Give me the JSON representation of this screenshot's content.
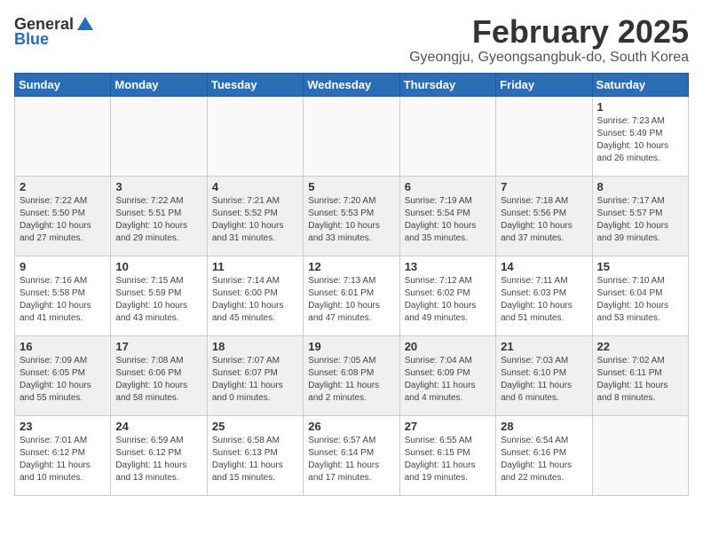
{
  "header": {
    "logo_general": "General",
    "logo_blue": "Blue",
    "month_title": "February 2025",
    "subtitle": "Gyeongju, Gyeongsangbuk-do, South Korea"
  },
  "weekdays": [
    "Sunday",
    "Monday",
    "Tuesday",
    "Wednesday",
    "Thursday",
    "Friday",
    "Saturday"
  ],
  "weeks": [
    [
      {
        "day": "",
        "info": ""
      },
      {
        "day": "",
        "info": ""
      },
      {
        "day": "",
        "info": ""
      },
      {
        "day": "",
        "info": ""
      },
      {
        "day": "",
        "info": ""
      },
      {
        "day": "",
        "info": ""
      },
      {
        "day": "1",
        "info": "Sunrise: 7:23 AM\nSunset: 5:49 PM\nDaylight: 10 hours\nand 26 minutes."
      }
    ],
    [
      {
        "day": "2",
        "info": "Sunrise: 7:22 AM\nSunset: 5:50 PM\nDaylight: 10 hours\nand 27 minutes."
      },
      {
        "day": "3",
        "info": "Sunrise: 7:22 AM\nSunset: 5:51 PM\nDaylight: 10 hours\nand 29 minutes."
      },
      {
        "day": "4",
        "info": "Sunrise: 7:21 AM\nSunset: 5:52 PM\nDaylight: 10 hours\nand 31 minutes."
      },
      {
        "day": "5",
        "info": "Sunrise: 7:20 AM\nSunset: 5:53 PM\nDaylight: 10 hours\nand 33 minutes."
      },
      {
        "day": "6",
        "info": "Sunrise: 7:19 AM\nSunset: 5:54 PM\nDaylight: 10 hours\nand 35 minutes."
      },
      {
        "day": "7",
        "info": "Sunrise: 7:18 AM\nSunset: 5:56 PM\nDaylight: 10 hours\nand 37 minutes."
      },
      {
        "day": "8",
        "info": "Sunrise: 7:17 AM\nSunset: 5:57 PM\nDaylight: 10 hours\nand 39 minutes."
      }
    ],
    [
      {
        "day": "9",
        "info": "Sunrise: 7:16 AM\nSunset: 5:58 PM\nDaylight: 10 hours\nand 41 minutes."
      },
      {
        "day": "10",
        "info": "Sunrise: 7:15 AM\nSunset: 5:59 PM\nDaylight: 10 hours\nand 43 minutes."
      },
      {
        "day": "11",
        "info": "Sunrise: 7:14 AM\nSunset: 6:00 PM\nDaylight: 10 hours\nand 45 minutes."
      },
      {
        "day": "12",
        "info": "Sunrise: 7:13 AM\nSunset: 6:01 PM\nDaylight: 10 hours\nand 47 minutes."
      },
      {
        "day": "13",
        "info": "Sunrise: 7:12 AM\nSunset: 6:02 PM\nDaylight: 10 hours\nand 49 minutes."
      },
      {
        "day": "14",
        "info": "Sunrise: 7:11 AM\nSunset: 6:03 PM\nDaylight: 10 hours\nand 51 minutes."
      },
      {
        "day": "15",
        "info": "Sunrise: 7:10 AM\nSunset: 6:04 PM\nDaylight: 10 hours\nand 53 minutes."
      }
    ],
    [
      {
        "day": "16",
        "info": "Sunrise: 7:09 AM\nSunset: 6:05 PM\nDaylight: 10 hours\nand 55 minutes."
      },
      {
        "day": "17",
        "info": "Sunrise: 7:08 AM\nSunset: 6:06 PM\nDaylight: 10 hours\nand 58 minutes."
      },
      {
        "day": "18",
        "info": "Sunrise: 7:07 AM\nSunset: 6:07 PM\nDaylight: 11 hours\nand 0 minutes."
      },
      {
        "day": "19",
        "info": "Sunrise: 7:05 AM\nSunset: 6:08 PM\nDaylight: 11 hours\nand 2 minutes."
      },
      {
        "day": "20",
        "info": "Sunrise: 7:04 AM\nSunset: 6:09 PM\nDaylight: 11 hours\nand 4 minutes."
      },
      {
        "day": "21",
        "info": "Sunrise: 7:03 AM\nSunset: 6:10 PM\nDaylight: 11 hours\nand 6 minutes."
      },
      {
        "day": "22",
        "info": "Sunrise: 7:02 AM\nSunset: 6:11 PM\nDaylight: 11 hours\nand 8 minutes."
      }
    ],
    [
      {
        "day": "23",
        "info": "Sunrise: 7:01 AM\nSunset: 6:12 PM\nDaylight: 11 hours\nand 10 minutes."
      },
      {
        "day": "24",
        "info": "Sunrise: 6:59 AM\nSunset: 6:12 PM\nDaylight: 11 hours\nand 13 minutes."
      },
      {
        "day": "25",
        "info": "Sunrise: 6:58 AM\nSunset: 6:13 PM\nDaylight: 11 hours\nand 15 minutes."
      },
      {
        "day": "26",
        "info": "Sunrise: 6:57 AM\nSunset: 6:14 PM\nDaylight: 11 hours\nand 17 minutes."
      },
      {
        "day": "27",
        "info": "Sunrise: 6:55 AM\nSunset: 6:15 PM\nDaylight: 11 hours\nand 19 minutes."
      },
      {
        "day": "28",
        "info": "Sunrise: 6:54 AM\nSunset: 6:16 PM\nDaylight: 11 hours\nand 22 minutes."
      },
      {
        "day": "",
        "info": ""
      }
    ]
  ]
}
